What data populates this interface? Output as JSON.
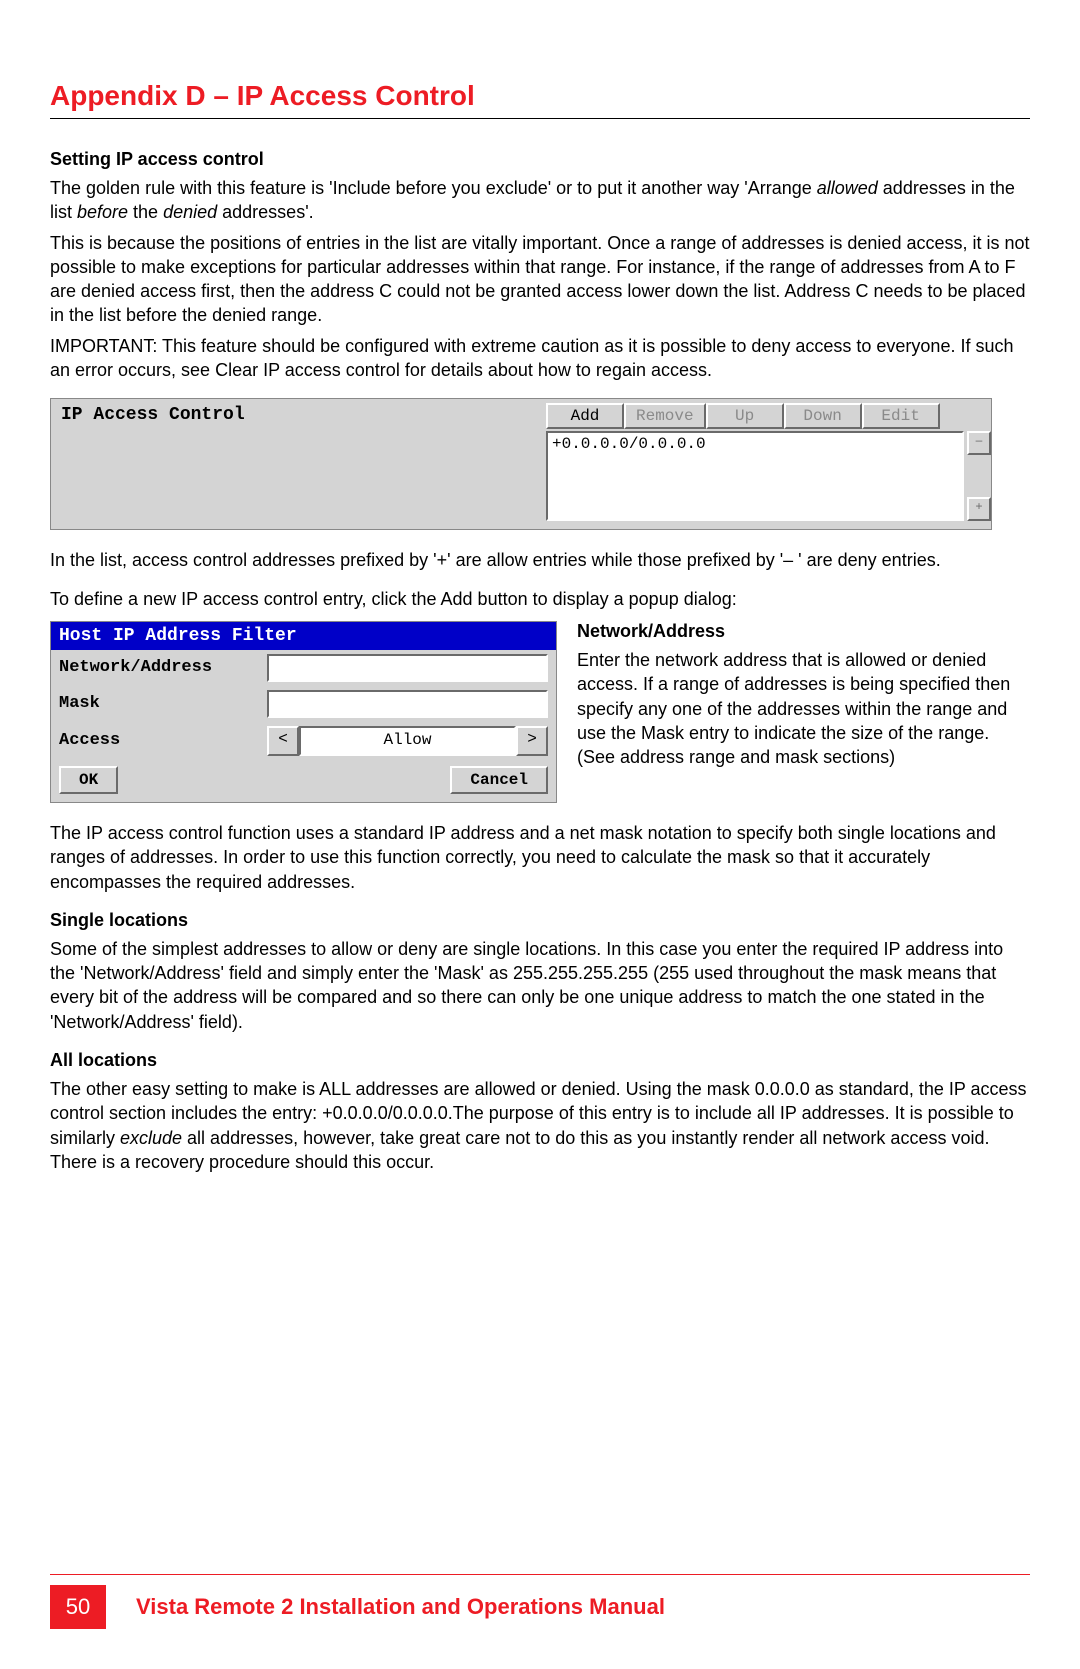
{
  "title": "Appendix D – IP Access Control",
  "s1": {
    "heading": "Setting IP access control",
    "p1a": "The golden rule with this feature is 'Include before you exclude' or to put it another way 'Arrange ",
    "p1b": "allowed",
    "p1c": " addresses in the list ",
    "p1d": "before",
    "p1e": " the ",
    "p1f": "denied",
    "p1g": " addresses'.",
    "p2": "This is because the positions of entries in the list are vitally important. Once a range of addresses is denied access, it is not possible to make exceptions for particular addresses within that range. For instance, if the range of addresses from A to F are denied access first, then the address C could not be granted access lower down the list. Address C needs to be placed in the list before the denied range.",
    "p3": "IMPORTANT: This feature should be configured with extreme caution as it is possible to deny access to everyone. If such an error occurs, see Clear IP access control for details about how to regain access."
  },
  "panel1": {
    "label": "IP Access Control",
    "buttons": {
      "add": "Add",
      "remove": "Remove",
      "up": "Up",
      "down": "Down",
      "edit": "Edit"
    },
    "list_entry": "+0.0.0.0/0.0.0.0"
  },
  "after_panel1": {
    "p1": "In the list, access control addresses prefixed by '+' are allow entries while those prefixed by '– ' are deny entries.",
    "p2": "To define a new IP access control entry, click the Add button to display a popup dialog:"
  },
  "panel2": {
    "title": "Host IP Address Filter",
    "network_label": "Network/Address",
    "mask_label": "Mask",
    "access_label": "Access",
    "access_value": "Allow",
    "ok": "OK",
    "cancel": "Cancel"
  },
  "side": {
    "heading": "Network/Address",
    "text": "Enter the network address that is allowed or denied access. If a range of addresses is being specified then specify any one of the addresses within the range and use the Mask entry to indicate the size of the range. (See address range and mask sections)"
  },
  "p_after": "The IP access control function uses a standard IP address and a net mask notation to specify both single locations and ranges of addresses. In order to use this function correctly, you need to calculate the mask so that it accurately encompasses the required addresses.",
  "single": {
    "heading": "Single locations",
    "text": "Some of the simplest addresses to allow or deny are single locations. In this case you enter the required IP address into the 'Network/Address' field and simply enter the 'Mask' as 255.255.255.255 (255 used throughout the mask means that every bit of the address will be compared and so there can only be one unique address to match the one stated in the 'Network/Address' field)."
  },
  "all": {
    "heading": "All locations",
    "t1": "The other easy setting to make is ALL addresses are allowed or denied.  Using the mask 0.0.0.0 as standard, the IP access control section includes the entry: +0.0.0.0/0.0.0.0.The purpose of this entry is to include all IP addresses. It is possible to similarly ",
    "t2": "exclude",
    "t3": " all addresses, however, take great care not to do this as you instantly render all network access void. There is a recovery procedure should this occur."
  },
  "footer": {
    "page": "50",
    "title": "Vista Remote 2 Installation and Operations Manual"
  }
}
